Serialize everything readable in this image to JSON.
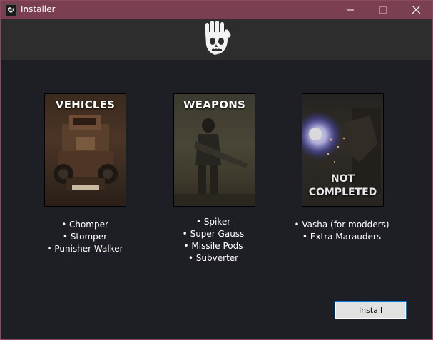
{
  "window": {
    "title": "Installer",
    "accent": "#7a3f51",
    "icons": [
      "app-icon",
      "minimize-icon",
      "maximize-icon",
      "close-icon"
    ]
  },
  "header": {
    "logo": "hand-skull-logo-icon"
  },
  "cards": [
    {
      "title": "VEHICLES",
      "overlay": "",
      "items": [
        "Chomper",
        "Stomper",
        "Punisher Walker"
      ]
    },
    {
      "title": "WEAPONS",
      "overlay": "",
      "items": [
        "Spiker",
        "Super Gauss",
        "Missile Pods",
        "Subverter"
      ]
    },
    {
      "title": "",
      "overlay_line1": "NOT",
      "overlay_line2": "COMPLETED",
      "items": [
        "Vasha (for modders)",
        "Extra Marauders"
      ]
    }
  ],
  "footer": {
    "install_label": "Install"
  }
}
